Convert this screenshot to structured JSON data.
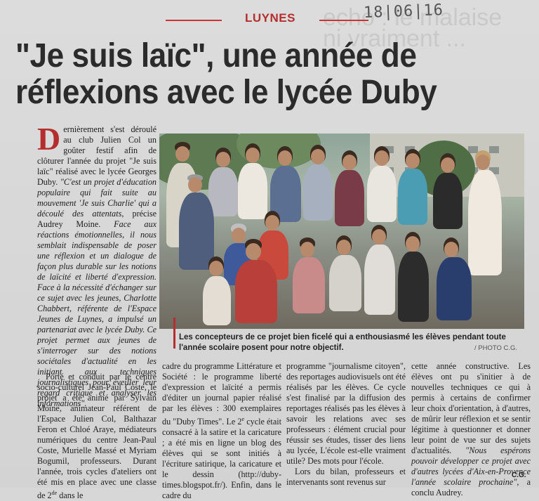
{
  "handwritten_date": "18|06|16",
  "ghost_text": [
    "echo : le malaise",
    "ni vraiment ..."
  ],
  "section": "LUYNES",
  "headline": "\"Je suis laïc\", une année de réflexions avec le lycée Duby",
  "lead": {
    "dropcap": "D",
    "text_plain_1": "ernièrement s'est déroulé au club Julien Col un goûter festif afin de clôturer l'année du projet \"Je suis laïc\" réalisé avec le lycée Georges Duby. ",
    "text_italic_1": "\"C'est un projet d'éducation populaire qui fait suite au mouvement 'Je suis Charlie' qui a découlé des attentats,",
    "text_plain_2": " précise Audrey Moine. ",
    "text_italic_2": "Face aux réactions émotionnelles, il nous semblait indispensable de poser une réflexion et un dialogue de façon plus durable sur les notions de laïcité et liberté d'expression. Face à la nécessité d'échanger sur ce sujet avec les jeunes, Charlotte Chabbert, référente de l'Espace Jeunes de Luynes, a impulsé un partenariat avec le lycée Duby. Ce projet permet aux jeunes de s'interroger sur des notions sociétales d'actualité en les initiant aux techniques journalistiques pour éveiller leur regard critique et analyser les informations\"."
  },
  "columns": {
    "col1": "Porté et conduit par le centre socio-culturel Jean-Paul Coste, le projet a été animé par Sylvain Moine, animateur référent de l'Espace Julien Col, Balthazar Feron et Chloé Araye, médiateurs numériques du centre Jean-Paul Coste, Murielle Massé et Myriam Bogumil, professeurs. Durant l'année, trois cycles d'ateliers ont été mis en place avec une classe de 2",
    "col1_sup": "de",
    "col1_end": " dans le",
    "col2": "cadre du programme Littérature et Société : le programme liberté d'expression et laïcité a permis d'éditer un journal papier réalisé par les élèves : 300 exemplaires du \"Duby Times\". Le 2",
    "col2_sup": "e",
    "col2_end": " cycle était consacré à la satire et la caricature ; a été mis en ligne un blog des élèves qui se sont initiés à l'écriture satirique, la caricature et le dessin (http://duby-times.blogspot.fr/). Enfin, dans le cadre du",
    "col3_p1": "programme \"journalisme citoyen\", des reportages audiovisuels ont été réalisés par les élèves. Ce cycle s'est finalisé par la diffusion des reportages réalisés pas les élèves à savoir les relations avec ses professeurs : élément crucial pour réussir ses études, tisser des liens au lycée, L'école est-elle vraiment utile? Des mots pour l'école.",
    "col3_p2": "Lors du bilan, professeurs et intervenants sont revenus sur",
    "col4_plain": "cette année constructive. Les élèves ont pu s'initier à de nouvelles techniques ce qui à permis à certains de confirmer leur choix d'orientation, à d'autres, de mûrir leur réflexion et se sentir légitime à questionner et donner leur point de vue sur des sujets d'actualités. ",
    "col4_italic": "\"Nous espérons pouvoir développer ce projet avec d'autres lycées d'Aix-en-Provence l'année scolaire prochaine\",",
    "col4_end": " a conclu Audrey."
  },
  "caption": "Les concepteurs de ce projet bien ficelé qui a enthousiasmé les élèves pendant toute l'année scolaire posent pour notre objectif.",
  "credit": "/ PHOTO C.G.",
  "signature": "C.G."
}
